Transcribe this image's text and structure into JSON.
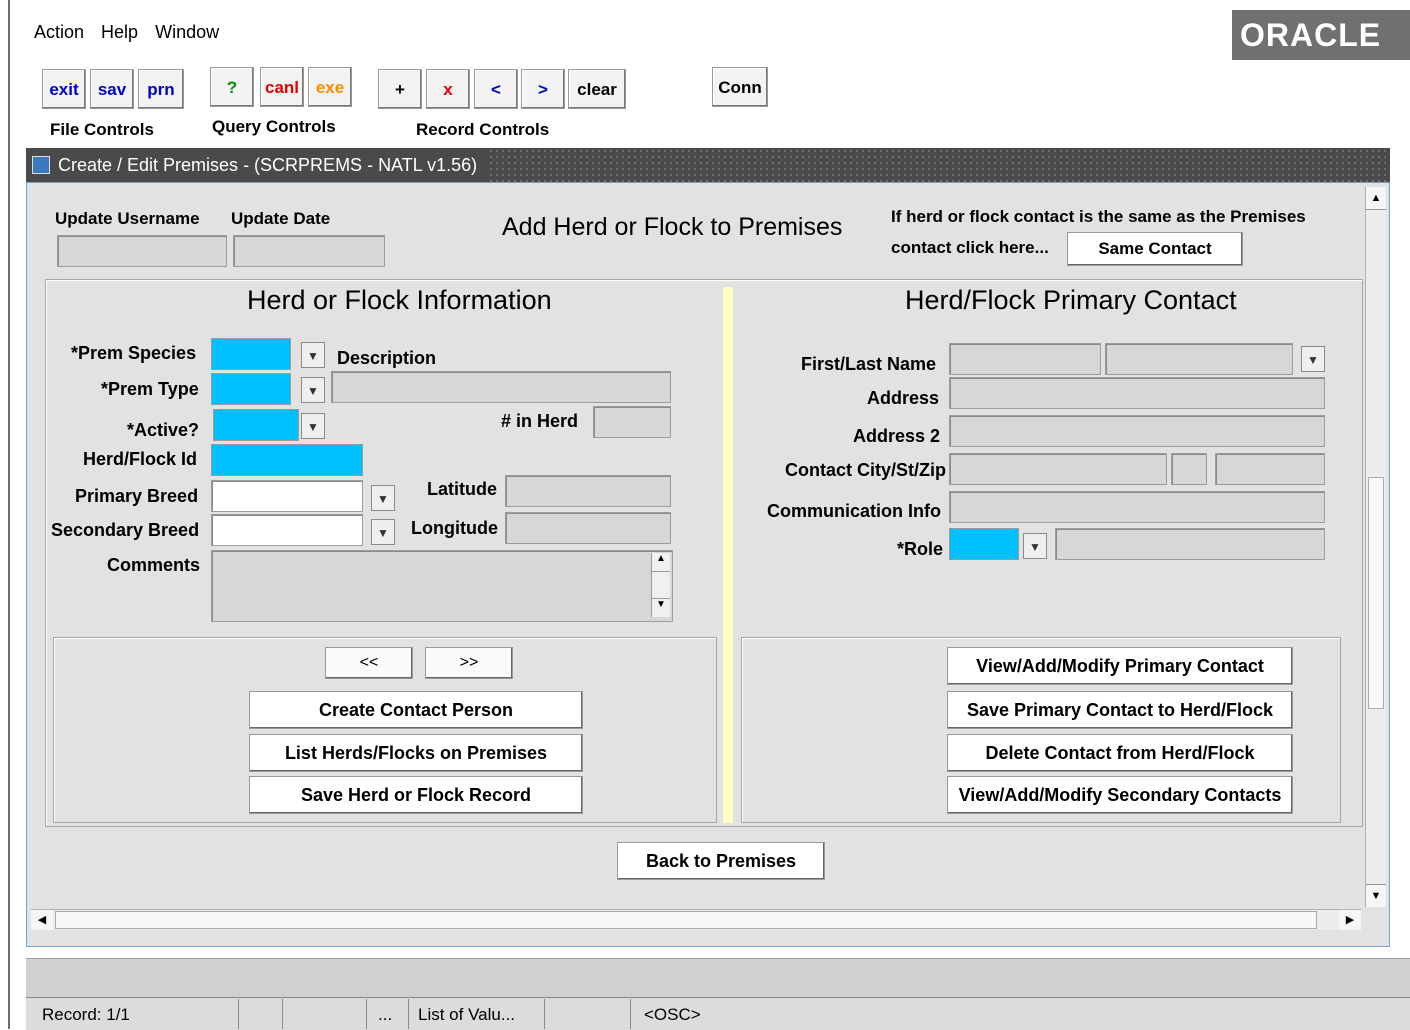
{
  "menu": {
    "action": "Action",
    "help": "Help",
    "window": "Window"
  },
  "brand": "ORACLE",
  "toolbar": {
    "exit": "exit",
    "sav": "sav",
    "prn": "prn",
    "help": "?",
    "canl": "canl",
    "exe": "exe",
    "add": "+",
    "del": "x",
    "prev": "<",
    "next": ">",
    "clear": "clear",
    "conn": "Conn",
    "file_controls": "File Controls",
    "query_controls": "Query Controls",
    "record_controls": "Record Controls"
  },
  "window": {
    "title": "Create / Edit Premises - (SCRPREMS - NATL v1.56)"
  },
  "header": {
    "update_username": "Update Username",
    "update_date": "Update Date",
    "form_title": "Add Herd or Flock to Premises",
    "same_contact_note_1": "If herd or flock contact is the same as the Premises",
    "same_contact_note_2": "contact click here...",
    "same_contact_button": "Same Contact"
  },
  "herd": {
    "title": "Herd or Flock Information",
    "prem_species": "*Prem Species",
    "description": "Description",
    "prem_type": "*Prem Type",
    "active": "*Active?",
    "in_herd": "# in Herd",
    "herd_flock_id": "Herd/Flock Id",
    "primary_breed": "Primary Breed",
    "latitude": "Latitude",
    "secondary_breed": "Secondary Breed",
    "longitude": "Longitude",
    "comments": "Comments",
    "prev_button": "<<",
    "next_button": ">>",
    "create_contact": "Create Contact Person",
    "list_herds": "List Herds/Flocks on Premises",
    "save_record": "Save Herd or Flock Record"
  },
  "contact": {
    "title": "Herd/Flock Primary Contact",
    "first_last_name": "First/Last Name",
    "address": "Address",
    "address2": "Address 2",
    "city_st_zip": "Contact City/St/Zip",
    "communication": "Communication Info",
    "role": "*Role",
    "view_primary": "View/Add/Modify Primary Contact",
    "save_primary": "Save Primary Contact to Herd/Flock",
    "delete_contact": "Delete Contact from Herd/Flock",
    "view_secondary": "View/Add/Modify Secondary Contacts"
  },
  "back_button": "Back to Premises",
  "status": {
    "record": "Record: 1/1",
    "ellipsis": "...",
    "lov": "List of Valu...",
    "osc": "<OSC>"
  }
}
